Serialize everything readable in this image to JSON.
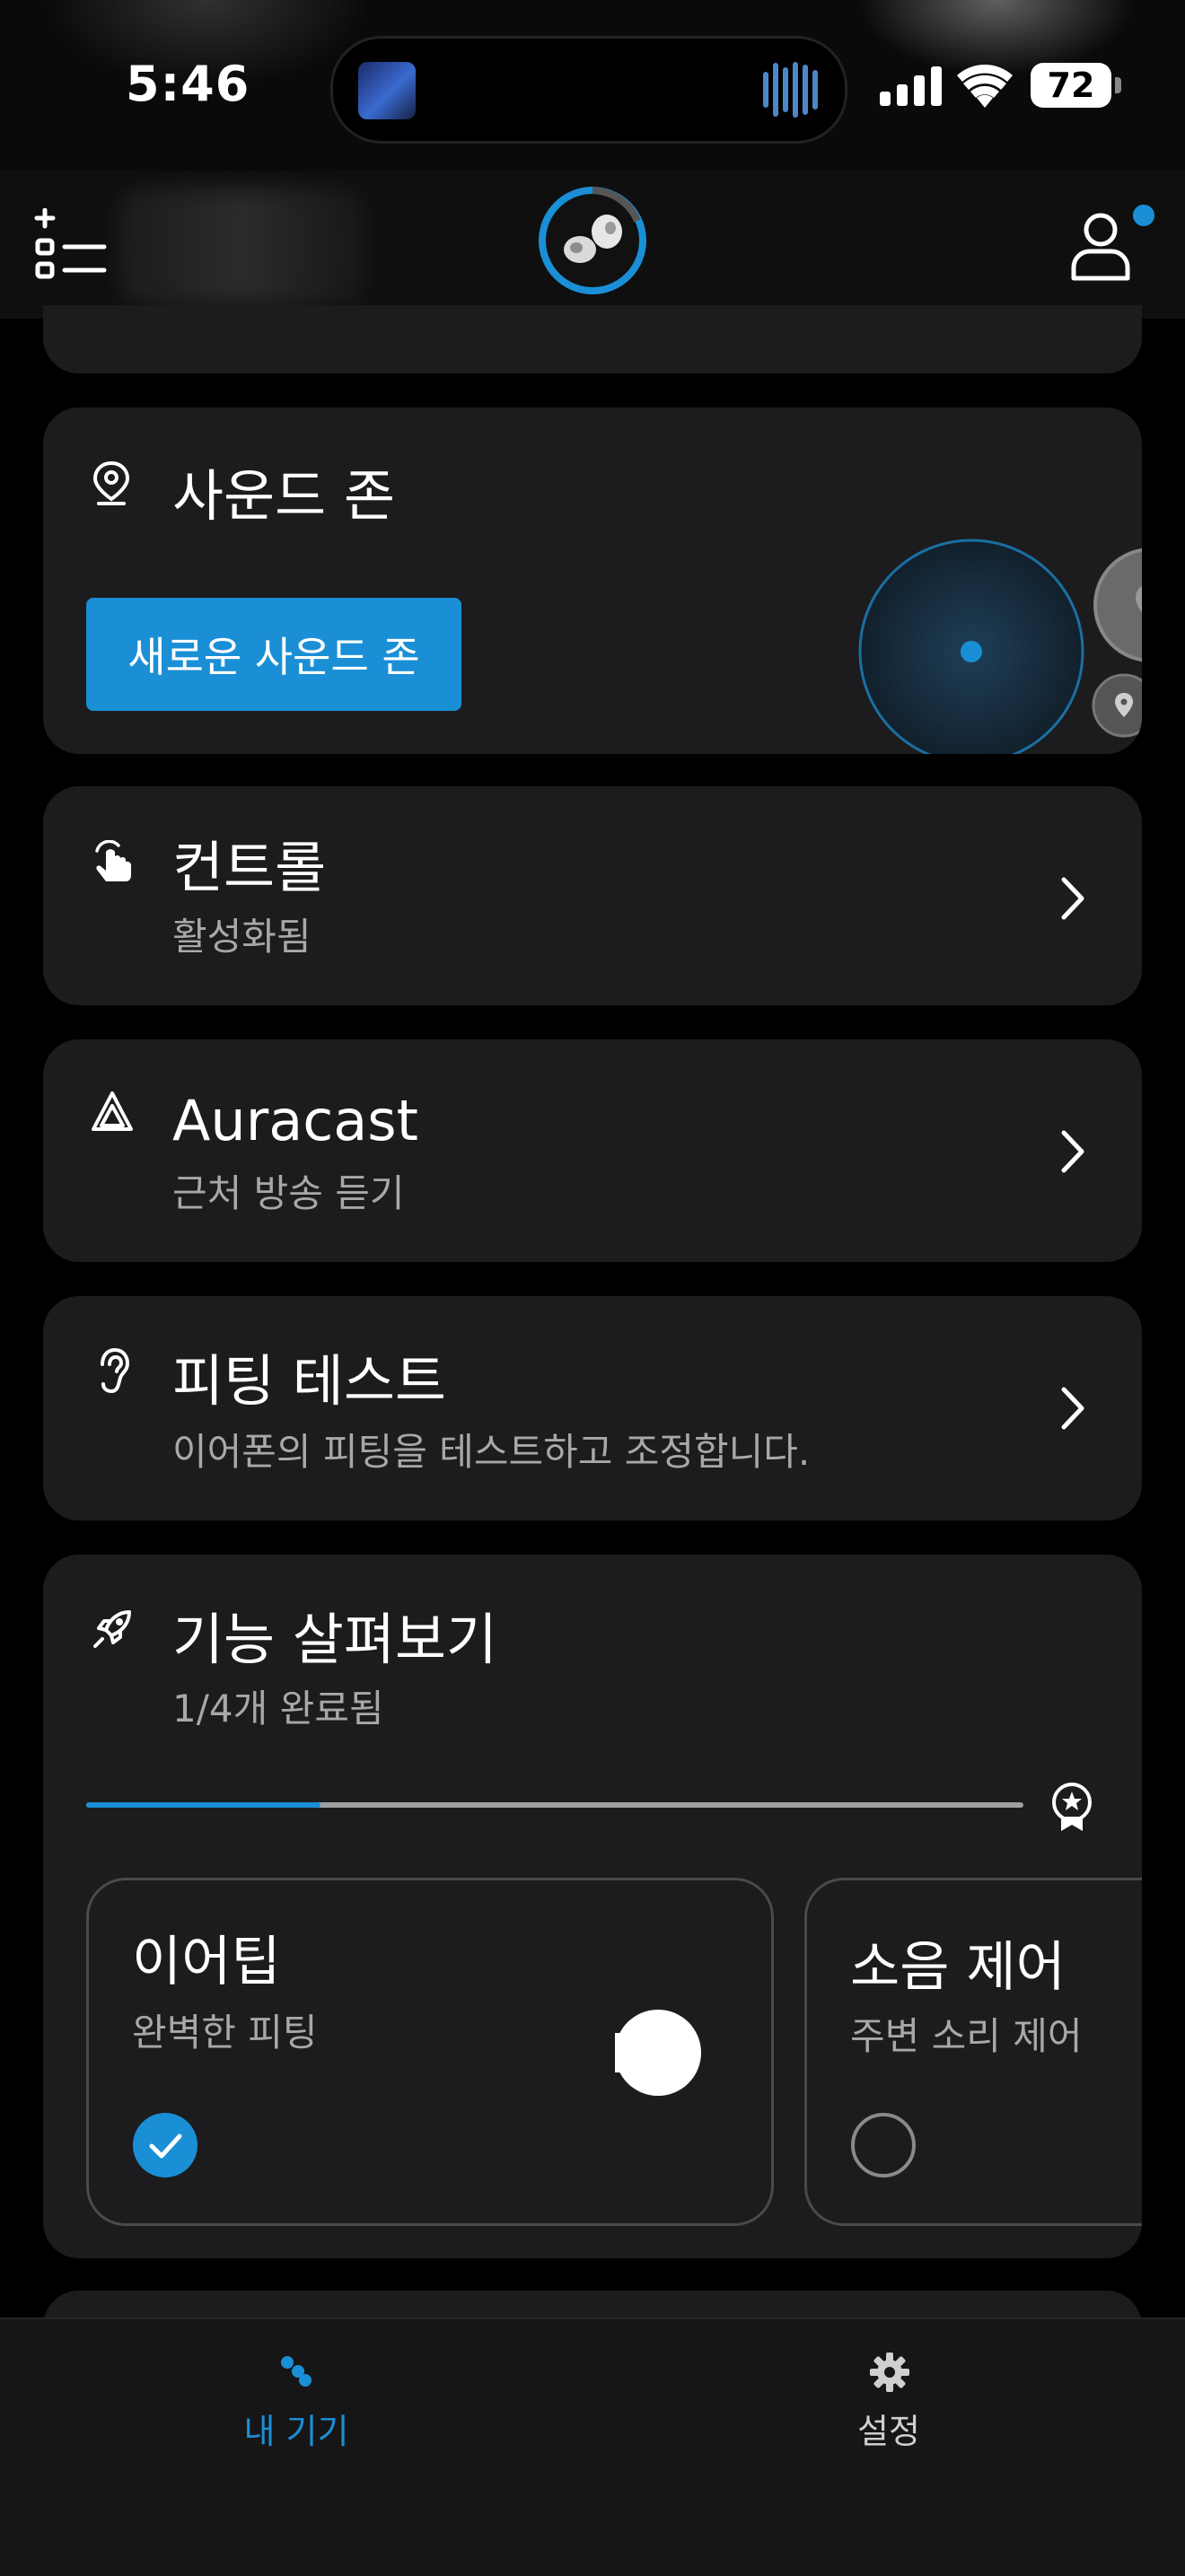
{
  "status_bar": {
    "time": "5:46",
    "battery": "72",
    "icons": [
      "signal-icon",
      "wifi-icon",
      "battery-icon"
    ],
    "now_playing_art": "album-art",
    "now_playing_indicator": "waveform-icon"
  },
  "header": {
    "left_icon": "add-list-icon",
    "center_icon": "earbuds-device-icon",
    "right_icon": "profile-icon",
    "notification_dot": true
  },
  "sound_zone": {
    "title": "사운드 존",
    "icon": "location-pin-icon",
    "button_label": "새로운 사운드 존",
    "map_icons": [
      "location-pin-icon",
      "location-pin-icon"
    ]
  },
  "controls": {
    "title": "컨트롤",
    "subtitle": "활성화됨",
    "icon": "touch-gesture-icon"
  },
  "auracast": {
    "title": "Auracast",
    "subtitle": "근처 방송 듣기",
    "icon": "auracast-icon"
  },
  "fit_test": {
    "title": "피팅 테스트",
    "subtitle": "이어폰의 피팅을 테스트하고 조정합니다.",
    "icon": "ear-icon"
  },
  "feature_tour": {
    "title": "기능 살펴보기",
    "subtitle": "1/4개 완료됨",
    "icon": "rocket-icon",
    "progress": 0.25,
    "reward_icon": "award-badge-icon",
    "items": [
      {
        "title": "이어팁",
        "subtitle": "완벽한 피팅",
        "completed": true
      },
      {
        "title": "소음 제어",
        "subtitle": "주변 소리 제어",
        "completed": false
      }
    ]
  },
  "bottom_nav": {
    "items": [
      {
        "label": "내 기기",
        "icon": "my-devices-icon",
        "active": true
      },
      {
        "label": "설정",
        "icon": "gear-icon",
        "active": false
      }
    ]
  },
  "colors": {
    "accent": "#1a8fd6",
    "card": "#1c1c1e",
    "background": "#000000",
    "subtext": "#a8a8a8"
  }
}
